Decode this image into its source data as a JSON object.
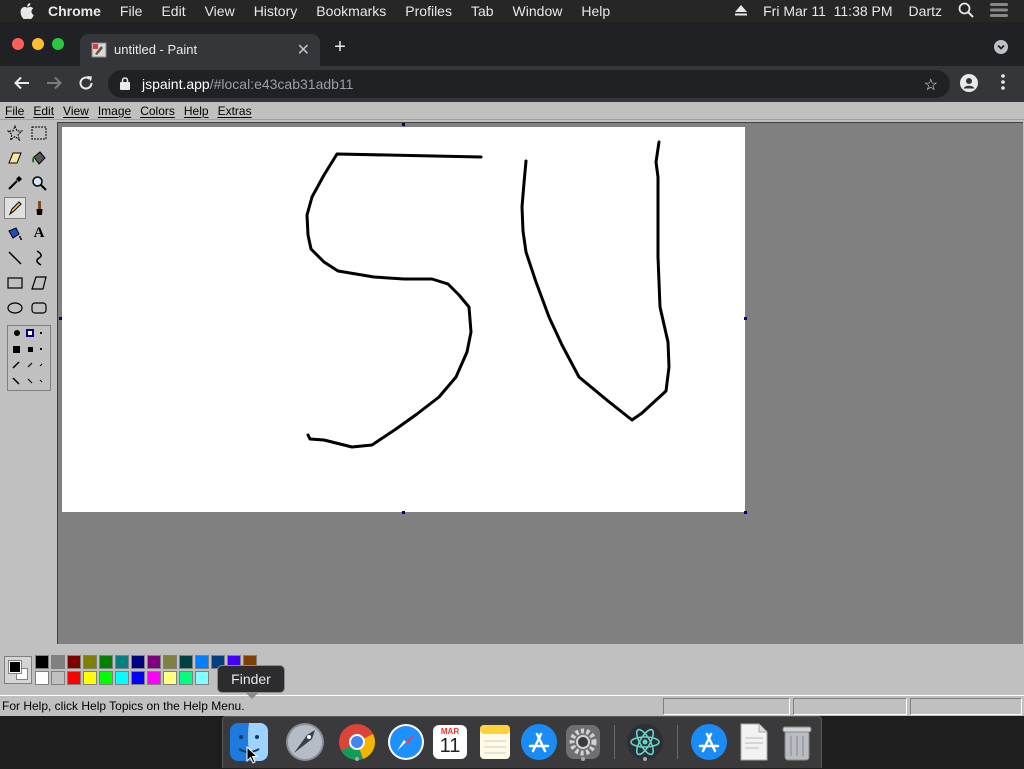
{
  "mac_menubar": {
    "app_name": "Chrome",
    "items": [
      "File",
      "Edit",
      "View",
      "History",
      "Bookmarks",
      "Profiles",
      "Tab",
      "Window",
      "Help"
    ],
    "clock": "Fri Mar 11  11:38 PM",
    "user": "Dartz",
    "icons": [
      "apple-icon",
      "eject-icon",
      "spotlight-search-icon",
      "control-center-icon"
    ]
  },
  "browser": {
    "tab_title": "untitled - Paint",
    "url_host": "jspaint.app",
    "url_path": "/#local:e43cab31adb11",
    "icons": [
      "back-icon",
      "forward-icon",
      "reload-icon",
      "lock-icon",
      "star-icon",
      "profile-icon",
      "kebab-menu-icon"
    ]
  },
  "paint": {
    "menu": [
      "File",
      "Edit",
      "View",
      "Image",
      "Colors",
      "Help",
      "Extras"
    ],
    "tools": [
      {
        "name": "free-form-select",
        "icon": "star-select-icon"
      },
      {
        "name": "select",
        "icon": "rect-select-icon"
      },
      {
        "name": "eraser",
        "icon": "eraser-icon"
      },
      {
        "name": "fill",
        "icon": "fill-bucket-icon"
      },
      {
        "name": "pick-color",
        "icon": "eyedropper-icon"
      },
      {
        "name": "magnifier",
        "icon": "magnifier-icon"
      },
      {
        "name": "pencil",
        "icon": "pencil-icon",
        "selected": true
      },
      {
        "name": "brush",
        "icon": "brush-icon"
      },
      {
        "name": "airbrush",
        "icon": "airbrush-icon"
      },
      {
        "name": "text",
        "icon": "text-icon",
        "glyph": "A"
      },
      {
        "name": "line",
        "icon": "line-icon"
      },
      {
        "name": "curve",
        "icon": "curve-icon"
      },
      {
        "name": "rectangle",
        "icon": "rectangle-icon"
      },
      {
        "name": "polygon",
        "icon": "polygon-icon"
      },
      {
        "name": "ellipse",
        "icon": "ellipse-icon"
      },
      {
        "name": "rounded-rectangle",
        "icon": "rounded-rectangle-icon"
      }
    ],
    "palette_top": [
      "#000000",
      "#808080",
      "#800000",
      "#808000",
      "#008000",
      "#008080",
      "#000080",
      "#800080",
      "#808040",
      "#004040",
      "#0080ff",
      "#004080",
      "#4000ff",
      "#804000"
    ],
    "palette_bottom": [
      "#ffffff",
      "#c0c0c0",
      "#ff0000",
      "#ffff00",
      "#00ff00",
      "#00ffff",
      "#0000ff",
      "#ff00ff",
      "#ffff80",
      "#00ff80",
      "#80ffff"
    ],
    "foreground_color": "#000000",
    "background_color": "#ffffff",
    "status_text": "For Help, click Help Topics on the Help Menu."
  },
  "dock": {
    "tooltip": "Finder",
    "apps": [
      "Finder",
      "Launchpad",
      "Google Chrome",
      "Safari",
      "Calendar",
      "Notes",
      "App Store",
      "System Preferences",
      "Atom",
      "App Store Downloads",
      "Document",
      "Trash"
    ],
    "calendar_month": "MAR",
    "calendar_day": "11"
  }
}
